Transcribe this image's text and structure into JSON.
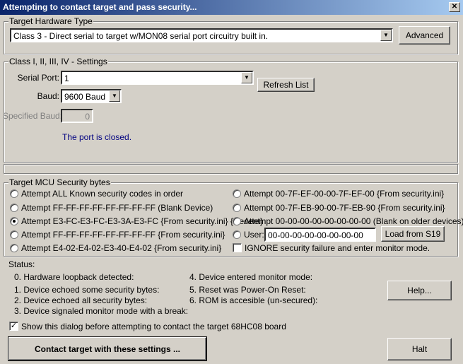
{
  "title": "Attempting to contact target and pass security...",
  "hardware": {
    "legend": "Target Hardware Type",
    "selected": "Class 3 - Direct serial to target w/MON08 serial port circuitry built in.",
    "advanced_label": "Advanced"
  },
  "settings": {
    "legend": "Class I, II, III, IV - Settings",
    "serial_port_label": "Serial Port:",
    "serial_port_value": "1",
    "refresh_label": "Refresh List",
    "baud_label": "Baud:",
    "baud_value": "9600 Baud",
    "specified_baud_label": "Specified Baud:",
    "specified_baud_value": "0",
    "port_status": "The port is closed."
  },
  "security": {
    "legend": "Target MCU Security bytes",
    "left": [
      "Attempt ALL Known security codes in order",
      "Attempt FF-FF-FF-FF-FF-FF-FF-FF (Blank Device)",
      "Attempt E3-FC-E3-FC-E3-3A-E3-FC {From security.ini} {Recent}",
      "Attempt FF-FF-FF-FF-FF-FF-FF-FF {From security.ini}",
      "Attempt E4-02-E4-02-E3-40-E4-02 {From security.ini}"
    ],
    "right": [
      "Attempt 00-7F-EF-00-00-7F-EF-00 {From security.ini}",
      "Attempt 00-7F-EB-90-00-7F-EB-90 {From security.ini}",
      "Attempt 00-00-00-00-00-00-00-00 (Blank on older devices)"
    ],
    "user_label": "User:",
    "user_value": "00-00-00-00-00-00-00-00",
    "load_label": "Load from S19",
    "ignore_label": "IGNORE security failure and enter monitor mode.",
    "selected_index": 2,
    "ignore_checked": false
  },
  "status": {
    "label": "Status:",
    "left": [
      "0. Hardware loopback detected:",
      "1. Device echoed some security bytes:",
      "2. Device echoed all security bytes:",
      "3. Device signaled monitor mode with a break:"
    ],
    "right": [
      "4. Device entered monitor mode:",
      "5. Reset was Power-On Reset:",
      "6. ROM is accesible (un-secured):"
    ]
  },
  "help_label": "Help...",
  "show_dialog_label": "Show this dialog before attempting to contact the target 68HC08 board",
  "show_dialog_checked": true,
  "contact_label": "Contact target with these settings ...",
  "halt_label": "Halt"
}
